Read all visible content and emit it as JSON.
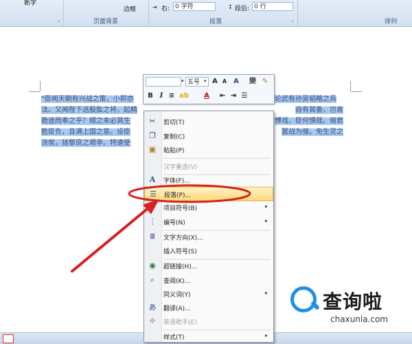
{
  "ribbon": {
    "partial_label_1": "断字",
    "border_label": "边框",
    "page_bg_group": "页面背景",
    "paragraph_group": "段落",
    "arrange_group": "排列",
    "right_label": "右:",
    "right_value": "0 字符",
    "after_label": "段后:",
    "after_value": "0 行"
  },
  "document": {
    "paragraph": "\"臣闻天朝有兴战之策，小邦亦……论武有孙吴韬略之兵法。又闻陛下选股肱之将，起精锐之师，来侵臣境，水浸之地，山海之洲，自有其备，岂肯跪途而奉之乎？顺之未必其生……博戏，臣何惧哉。倘君胜臣负，且满上国之意。设臣……罢战为强，免生灵之涂炭，拯黎庶之艰辛。特遣使……",
    "line1": "\"臣闻天朝有兴战之策，小邦亦",
    "line1_end": "论武有孙吴韬略之兵",
    "line2": "法。又闻陛下选股肱之将，起精",
    "line2_end": "自有其备，岂肯",
    "line3": "跪途而奉之乎？顺之未必其生",
    "line3_end": "博戏，臣何惧哉。倘君",
    "line4": "胜臣负，且满上国之意。设臣",
    "line4_end": "罢战为强，免生灵之",
    "line5": "涂炭，拯黎庶之艰辛。特遣使"
  },
  "minibar": {
    "font_size": "五号",
    "grow_font": "A",
    "shrink_font": "A",
    "bold": "B",
    "italic": "I",
    "font_color": "A"
  },
  "context_menu": {
    "items": [
      {
        "label": "剪切(T)",
        "icon": "scissors-icon",
        "disabled": false
      },
      {
        "label": "复制(C)",
        "icon": "copy-icon",
        "disabled": false
      },
      {
        "label": "粘贴(P)",
        "icon": "paste-icon",
        "disabled": false
      },
      {
        "label": "汉字重选(V)",
        "icon": "",
        "disabled": true
      },
      {
        "label": "字体(F)...",
        "icon": "font-icon",
        "disabled": false
      },
      {
        "label": "段落(P)...",
        "icon": "paragraph-icon",
        "disabled": false,
        "highlight": true
      },
      {
        "label": "项目符号(B)",
        "icon": "bullets-icon",
        "disabled": false,
        "submenu": true
      },
      {
        "label": "编号(N)",
        "icon": "numbering-icon",
        "disabled": false,
        "submenu": true
      },
      {
        "label": "文字方向(X)...",
        "icon": "text-direction-icon",
        "disabled": false
      },
      {
        "label": "插入符号(S)",
        "icon": "",
        "disabled": false
      },
      {
        "label": "超链接(H)...",
        "icon": "hyperlink-icon",
        "disabled": false
      },
      {
        "label": "查阅(K)...",
        "icon": "research-icon",
        "disabled": false
      },
      {
        "label": "同义词(Y)",
        "icon": "",
        "disabled": false,
        "submenu": true
      },
      {
        "label": "翻译(A)...",
        "icon": "translate-icon",
        "disabled": false
      },
      {
        "label": "英语助手(E)",
        "icon": "english-assistant-icon",
        "disabled": true
      },
      {
        "label": "样式(T)",
        "icon": "",
        "disabled": false,
        "submenu": true
      }
    ]
  },
  "watermark": {
    "title": "查询啦",
    "url": "chaxunla.com"
  },
  "colors": {
    "highlight_text": "#a8c8ee",
    "annotation_red": "#d42020",
    "watermark_blue": "#1e8fe6"
  }
}
